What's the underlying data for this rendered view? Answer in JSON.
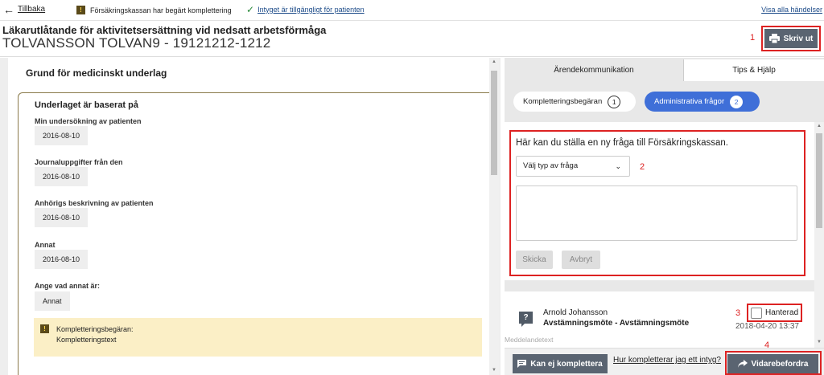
{
  "topbar": {
    "back_label": "Tillbaka",
    "notice": "Försäkringskassan har begärt komplettering",
    "available": "Intyget är tillgängligt för patienten",
    "show_all": "Visa alla händelser"
  },
  "header": {
    "title": "Läkarutlåtande för aktivitetsersättning vid nedsatt arbetsförmåga",
    "patient": "TOLVANSSON TOLVAN9 - 19121212-1212",
    "print_label": "Skriv ut"
  },
  "annotations": [
    "1",
    "2",
    "3",
    "4"
  ],
  "form": {
    "section_title": "Grund för medicinskt underlag",
    "group_title": "Underlaget är baserat på",
    "fields": [
      {
        "label": "Min undersökning av patienten",
        "value": "2016-08-10"
      },
      {
        "label": "Journaluppgifter från den",
        "value": "2016-08-10"
      },
      {
        "label": "Anhörigs beskrivning av patienten",
        "value": "2016-08-10"
      },
      {
        "label": "Annat",
        "value": "2016-08-10"
      },
      {
        "label": "Ange vad annat är:",
        "value": "Annat"
      }
    ],
    "alert_title": "Kompletteringsbegäran:",
    "alert_text": "Kompletteringstext"
  },
  "sidepanel": {
    "tabs": [
      "Ärendekommunikation",
      "Tips & Hjälp"
    ],
    "pills": [
      {
        "label": "Kompletteringsbegäran",
        "count": "1"
      },
      {
        "label": "Administrativa frågor",
        "count": "2"
      }
    ],
    "new_question": {
      "title": "Här kan du ställa en ny fråga till Försäkringskassan.",
      "select_value": "Välj typ av fråga",
      "send_label": "Skicka",
      "cancel_label": "Avbryt"
    },
    "message": {
      "author": "Arnold Johansson",
      "subject": "Avstämningsmöte - Avstämningsmöte",
      "timestamp": "2018-04-20 13:37",
      "handled_label": "Hanterad",
      "preview": "Meddelandetext"
    },
    "bottom": {
      "cannot_complete": "Kan ej komplettera",
      "how_link": "Hur kompletterar jag ett intyg?",
      "forward": "Vidarebefordra"
    }
  },
  "colors": {
    "accent": "#3f6fd8",
    "annotation": "#dd2222",
    "alert_bg": "#fbefc6",
    "dark_button": "#5a6471"
  },
  "icons": [
    "arrow-left-icon",
    "warning-icon",
    "checkmark-icon",
    "printer-icon",
    "chevron-down-icon",
    "question-icon",
    "message-icon",
    "forward-icon"
  ]
}
